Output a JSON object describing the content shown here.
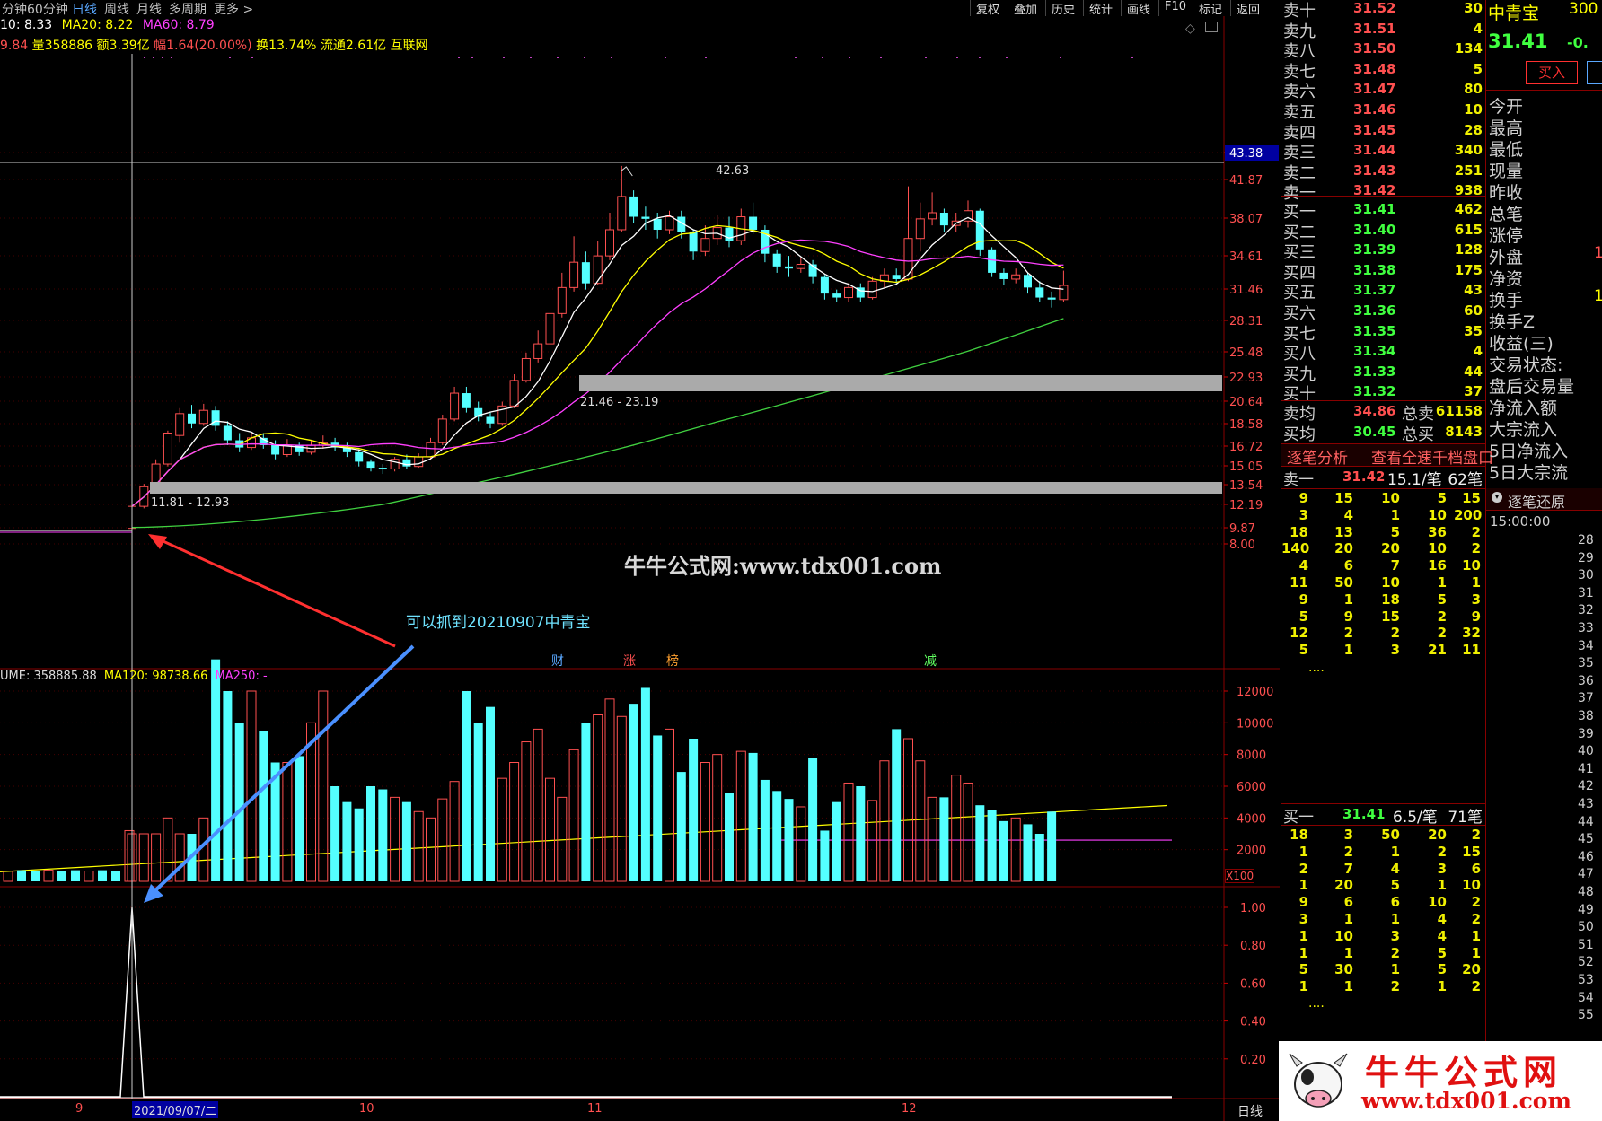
{
  "toolbar": {
    "left": [
      "分钟",
      "60分钟",
      "日线",
      "周线",
      "月线",
      "多周期",
      "更多 >"
    ],
    "active": "日线",
    "right": [
      "复权",
      "叠加",
      "历史",
      "统计",
      "画线",
      "F10",
      "标记",
      "返回"
    ]
  },
  "ma_line": {
    "ma10": "10: 8.33",
    "ma20": "MA20: 8.22",
    "ma60": "MA60: 8.79"
  },
  "info_line": {
    "price": "9.84",
    "vol": "量358886",
    "amount": "额3.39亿",
    "change": "幅1.64(20.00%)",
    "turnover": "换13.74%",
    "float": "流通2.61亿",
    "industry": "互联网"
  },
  "price_axis": [
    "43.38",
    "41.87",
    "38.07",
    "34.61",
    "31.46",
    "28.31",
    "25.48",
    "22.93",
    "20.64",
    "18.58",
    "16.72",
    "15.05",
    "13.54",
    "12.19",
    "9.87",
    "8.00"
  ],
  "annotations": {
    "peak": "42.63",
    "zone_upper": "21.46 - 23.19",
    "zone_lower": "11.81 - 12.93",
    "watermark": "牛牛公式网:www.tdx001.com",
    "callout": "可以抓到20210907中青宝",
    "event_cai": "财",
    "event_zhang": "涨",
    "event_bang": "榜",
    "event_jian": "减"
  },
  "volume_header": {
    "vol": "UME: 358885.88",
    "ma120": "MA120: 98738.66",
    "ma250": "MA250: -"
  },
  "volume_axis": [
    "12000",
    "10000",
    "8000",
    "6000",
    "4000",
    "2000"
  ],
  "volume_unit": "X100",
  "indicator_axis": [
    "1.00",
    "0.80",
    "0.60",
    "0.40",
    "0.20"
  ],
  "date_axis": {
    "m9": "9",
    "cursor": "2021/09/07/二",
    "m10": "10",
    "m11": "11",
    "m12": "12",
    "period": "日线"
  },
  "chart_data": {
    "type": "candlestick",
    "symbol": "中青宝",
    "ylim": [
      8.0,
      43.38
    ],
    "note_values_estimated": true,
    "candles": [
      [
        9.8,
        12.0,
        9.5,
        12.2
      ],
      [
        12.0,
        13.4,
        11.8,
        13.6
      ],
      [
        13.4,
        15.2,
        13.0,
        15.6
      ],
      [
        15.2,
        17.8,
        15.0,
        18.0
      ],
      [
        17.6,
        19.5,
        17.0,
        20.0
      ],
      [
        19.5,
        18.6,
        18.2,
        20.3
      ],
      [
        18.6,
        19.8,
        18.4,
        20.4
      ],
      [
        19.8,
        18.4,
        18.0,
        20.2
      ],
      [
        18.4,
        17.2,
        16.8,
        18.8
      ],
      [
        17.2,
        16.6,
        16.2,
        17.8
      ],
      [
        16.6,
        17.4,
        16.4,
        17.9
      ],
      [
        17.4,
        16.8,
        16.5,
        17.8
      ],
      [
        16.8,
        16.0,
        15.6,
        17.2
      ],
      [
        16.0,
        16.8,
        15.8,
        17.3
      ],
      [
        16.8,
        16.2,
        15.9,
        17.0
      ],
      [
        16.2,
        16.8,
        16.0,
        17.2
      ],
      [
        16.8,
        17.0,
        16.5,
        17.6
      ],
      [
        17.0,
        16.6,
        16.3,
        17.4
      ],
      [
        16.6,
        16.2,
        15.8,
        17.0
      ],
      [
        16.2,
        15.4,
        15.0,
        16.4
      ],
      [
        15.4,
        14.9,
        14.6,
        15.6
      ],
      [
        14.9,
        14.8,
        14.4,
        15.2
      ],
      [
        14.8,
        15.6,
        14.6,
        15.8
      ],
      [
        15.6,
        15.0,
        14.8,
        16.0
      ],
      [
        15.0,
        15.8,
        14.9,
        16.1
      ],
      [
        15.8,
        17.0,
        15.6,
        17.4
      ],
      [
        17.0,
        19.0,
        16.8,
        19.4
      ],
      [
        19.0,
        21.4,
        18.8,
        22.0
      ],
      [
        21.4,
        20.0,
        19.6,
        22.0
      ],
      [
        20.0,
        19.2,
        18.8,
        20.6
      ],
      [
        19.2,
        18.6,
        18.2,
        19.6
      ],
      [
        18.6,
        20.2,
        18.4,
        20.6
      ],
      [
        20.2,
        22.6,
        20.0,
        23.2
      ],
      [
        22.6,
        24.8,
        22.4,
        25.4
      ],
      [
        24.8,
        26.2,
        24.4,
        27.4
      ],
      [
        26.2,
        29.0,
        25.8,
        30.4
      ],
      [
        29.0,
        31.6,
        28.6,
        33.0
      ],
      [
        31.6,
        34.0,
        31.2,
        36.4
      ],
      [
        34.0,
        32.0,
        31.4,
        35.0
      ],
      [
        32.0,
        34.6,
        31.8,
        36.0
      ],
      [
        34.6,
        37.0,
        34.2,
        38.6
      ],
      [
        37.0,
        40.2,
        36.8,
        42.63
      ],
      [
        40.2,
        38.2,
        37.6,
        40.8
      ],
      [
        38.2,
        38.0,
        37.0,
        39.2
      ],
      [
        38.0,
        37.0,
        36.2,
        38.6
      ],
      [
        37.0,
        38.2,
        36.6,
        38.8
      ],
      [
        38.2,
        36.8,
        36.2,
        38.8
      ],
      [
        36.8,
        35.0,
        34.2,
        37.0
      ],
      [
        35.0,
        36.2,
        34.6,
        37.4
      ],
      [
        36.2,
        37.2,
        35.6,
        38.4
      ],
      [
        37.2,
        36.0,
        35.4,
        38.2
      ],
      [
        36.0,
        38.2,
        35.6,
        39.0
      ],
      [
        38.2,
        37.0,
        36.6,
        39.6
      ],
      [
        37.0,
        34.8,
        34.0,
        37.4
      ],
      [
        34.8,
        33.6,
        33.0,
        35.2
      ],
      [
        33.6,
        33.4,
        32.6,
        34.6
      ],
      [
        33.4,
        33.8,
        33.0,
        34.4
      ],
      [
        33.8,
        32.6,
        32.0,
        34.2
      ],
      [
        32.6,
        31.0,
        30.4,
        32.8
      ],
      [
        31.0,
        30.6,
        30.2,
        31.4
      ],
      [
        30.6,
        31.6,
        30.2,
        32.0
      ],
      [
        31.6,
        30.6,
        30.2,
        32.0
      ],
      [
        30.6,
        32.2,
        30.4,
        32.6
      ],
      [
        32.2,
        32.8,
        31.6,
        33.4
      ],
      [
        32.8,
        32.4,
        32.0,
        33.4
      ],
      [
        32.4,
        36.2,
        32.2,
        41.2
      ],
      [
        36.2,
        38.0,
        35.0,
        39.6
      ],
      [
        38.0,
        38.6,
        37.4,
        40.6
      ],
      [
        38.6,
        37.4,
        36.8,
        39.0
      ],
      [
        37.4,
        37.8,
        36.8,
        38.6
      ],
      [
        37.8,
        38.8,
        37.2,
        39.8
      ],
      [
        38.8,
        35.2,
        34.6,
        39.0
      ],
      [
        35.2,
        33.0,
        32.6,
        35.4
      ],
      [
        33.0,
        32.4,
        31.8,
        33.4
      ],
      [
        32.4,
        32.8,
        32.0,
        33.4
      ],
      [
        32.8,
        31.6,
        31.0,
        33.0
      ],
      [
        31.6,
        30.6,
        30.2,
        32.2
      ],
      [
        30.6,
        30.4,
        29.6,
        31.2
      ],
      [
        30.4,
        31.8,
        30.2,
        33.2
      ]
    ],
    "volume": [
      3000,
      3000,
      3000,
      4000,
      3000,
      3000,
      4000,
      14000,
      12000,
      10000,
      12000,
      9500,
      7500,
      7500,
      7900,
      10000,
      12000,
      6000,
      5000,
      4600,
      6000,
      5800,
      5300,
      5000,
      4400,
      4000,
      5200,
      6300,
      12000,
      10000,
      11000,
      6500,
      7500,
      8800,
      9600,
      6500,
      5300,
      8300,
      10000,
      10500,
      11500,
      10400,
      11200,
      12200,
      9200,
      9600,
      6900,
      9000,
      7500,
      8000,
      5600,
      8200,
      8100,
      6400,
      5700,
      5200,
      4700,
      7800,
      3200,
      5000,
      6200,
      6000,
      5100,
      7600,
      9600,
      9000,
      7600,
      5300,
      5300,
      6700,
      6200,
      4800,
      4500,
      3800,
      4000,
      3600,
      3000,
      4400
    ],
    "ma_volume_120_approx": 98738.66,
    "indicator_signal_date": "2021/09/07"
  },
  "right_panel": {
    "stock_name": "中青宝",
    "stock_code": "300",
    "last_price": "31.41",
    "change": "-0.",
    "buy_button": "买入",
    "asks": [
      {
        "label": "卖十",
        "price": "31.52",
        "vol": "30"
      },
      {
        "label": "卖九",
        "price": "31.51",
        "vol": "4"
      },
      {
        "label": "卖八",
        "price": "31.50",
        "vol": "134"
      },
      {
        "label": "卖七",
        "price": "31.48",
        "vol": "5"
      },
      {
        "label": "卖六",
        "price": "31.47",
        "vol": "80"
      },
      {
        "label": "卖五",
        "price": "31.46",
        "vol": "10"
      },
      {
        "label": "卖四",
        "price": "31.45",
        "vol": "28"
      },
      {
        "label": "卖三",
        "price": "31.44",
        "vol": "340"
      },
      {
        "label": "卖二",
        "price": "31.43",
        "vol": "251"
      },
      {
        "label": "卖一",
        "price": "31.42",
        "vol": "938"
      }
    ],
    "bids": [
      {
        "label": "买一",
        "price": "31.41",
        "vol": "462"
      },
      {
        "label": "买二",
        "price": "31.40",
        "vol": "615"
      },
      {
        "label": "买三",
        "price": "31.39",
        "vol": "128"
      },
      {
        "label": "买四",
        "price": "31.38",
        "vol": "175"
      },
      {
        "label": "买五",
        "price": "31.37",
        "vol": "43"
      },
      {
        "label": "买六",
        "price": "31.36",
        "vol": "60"
      },
      {
        "label": "买七",
        "price": "31.35",
        "vol": "35"
      },
      {
        "label": "买八",
        "price": "31.34",
        "vol": "4"
      },
      {
        "label": "买九",
        "price": "31.33",
        "vol": "44"
      },
      {
        "label": "买十",
        "price": "31.32",
        "vol": "37"
      }
    ],
    "avg_ask": {
      "label": "卖均",
      "price": "34.86",
      "total_label": "总卖",
      "total": "61158"
    },
    "avg_bid": {
      "label": "买均",
      "price": "30.45",
      "total_label": "总买",
      "total": "8143"
    },
    "tick_header": {
      "analysis": "逐笔分析",
      "view": "查看全速千档盘口"
    },
    "ask_ticks_header": {
      "label": "卖一",
      "price": "31.42",
      "per": "15.1/笔",
      "count": "62笔"
    },
    "ask_ticks": [
      [
        "9",
        "15",
        "10",
        "5",
        "15"
      ],
      [
        "3",
        "4",
        "1",
        "10",
        "200"
      ],
      [
        "18",
        "13",
        "5",
        "36",
        "2"
      ],
      [
        "140",
        "20",
        "20",
        "10",
        "2"
      ],
      [
        "4",
        "6",
        "7",
        "16",
        "10"
      ],
      [
        "11",
        "50",
        "10",
        "1",
        "1"
      ],
      [
        "9",
        "1",
        "18",
        "5",
        "3"
      ],
      [
        "5",
        "9",
        "15",
        "2",
        "9"
      ],
      [
        "12",
        "2",
        "2",
        "2",
        "32"
      ],
      [
        "5",
        "1",
        "3",
        "21",
        "11"
      ]
    ],
    "bid_ticks_header": {
      "label": "买一",
      "price": "31.41",
      "per": "6.5/笔",
      "count": "71笔"
    },
    "bid_ticks": [
      [
        "18",
        "3",
        "50",
        "20",
        "2"
      ],
      [
        "1",
        "2",
        "1",
        "2",
        "15"
      ],
      [
        "2",
        "7",
        "4",
        "3",
        "6"
      ],
      [
        "1",
        "20",
        "5",
        "1",
        "10"
      ],
      [
        "9",
        "6",
        "6",
        "10",
        "2"
      ],
      [
        "3",
        "1",
        "1",
        "4",
        "2"
      ],
      [
        "1",
        "10",
        "3",
        "4",
        "1"
      ],
      [
        "1",
        "1",
        "2",
        "5",
        "1"
      ],
      [
        "5",
        "30",
        "1",
        "5",
        "20"
      ],
      [
        "1",
        "1",
        "2",
        "1",
        "2"
      ]
    ],
    "ellipsis": "....",
    "stats": [
      "今开",
      "最高",
      "最低",
      "现量",
      "昨收",
      "总笔",
      "涨停",
      "外盘",
      "净资",
      "换手",
      "换手Z",
      "收益(三)",
      "交易状态:",
      "盘后交易量",
      "净流入额",
      "大宗流入",
      "5日净流入",
      "5日大宗流"
    ],
    "stats_values": {
      "外盘": "1",
      "换手": "1"
    },
    "replay_title": "逐笔还原",
    "replay_time": "15:00:00",
    "replay_rows": [
      "28",
      "29",
      "30",
      "31",
      "32",
      "33",
      "34",
      "35",
      "36",
      "37",
      "38",
      "39",
      "40",
      "41",
      "42",
      "43",
      "44",
      "45",
      "46",
      "47",
      "48",
      "49",
      "50",
      "51",
      "52",
      "53",
      "54",
      "55"
    ],
    "logo_text": "牛牛公式网",
    "logo_url": "www.tdx001.com"
  }
}
